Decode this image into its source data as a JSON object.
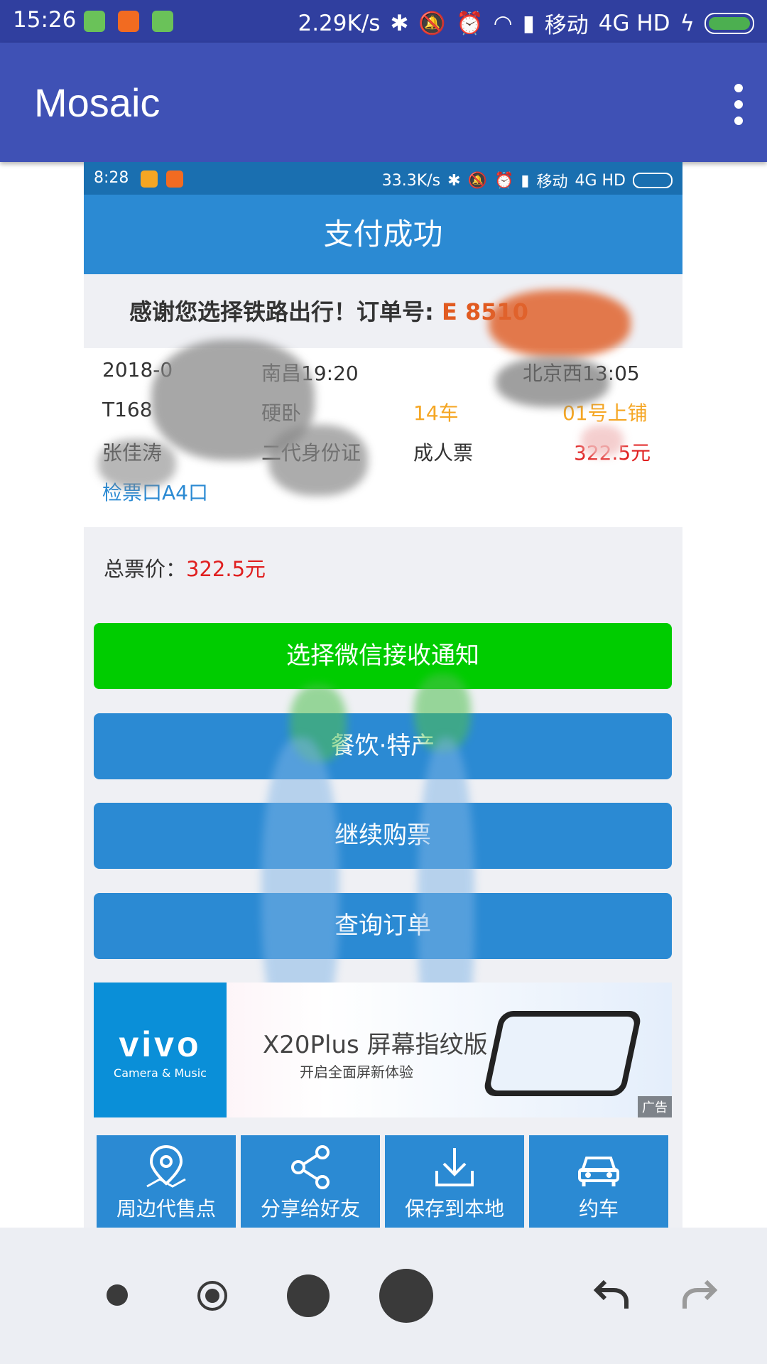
{
  "status_bar": {
    "time": "15:26",
    "net_speed": "2.29K/s",
    "carrier": "移动",
    "network": "4G HD"
  },
  "app_bar": {
    "title": "Mosaic"
  },
  "inner_screen": {
    "status_bar": {
      "time": "8:28",
      "net_speed": "33.3K/s",
      "carrier": "移动",
      "network": "4G HD"
    },
    "header_title": "支付成功",
    "thanks_label": "感谢您选择铁路出行！订单号: ",
    "order_no_visible": "E  8510",
    "ticket": {
      "date": "2018-0",
      "departure": "南昌19:20",
      "arrival": "北京西13:05",
      "train": "T168",
      "seat_class": "硬卧",
      "car": "14车",
      "berth": "01号上铺",
      "passenger": "张佳涛",
      "id_type": "二代身份证",
      "ticket_type": "成人票",
      "price": "322.5元",
      "gate": "检票口A4口"
    },
    "total_label": "总票价：",
    "total_price": "322.5元",
    "buttons": {
      "wechat": "选择微信接收通知",
      "food": "餐饮·特产",
      "buy_more": "继续购票",
      "orders": "查询订单"
    },
    "ad": {
      "brand": "vivo",
      "brand_sub": "Camera & Music",
      "headline": "X20Plus 屏幕指纹版",
      "subline": "开启全面屏新体验",
      "tag": "广告"
    },
    "tiles": [
      {
        "label": "周边代售点",
        "icon": "map-pin-icon"
      },
      {
        "label": "分享给好友",
        "icon": "share-icon"
      },
      {
        "label": "保存到本地",
        "icon": "download-icon"
      },
      {
        "label": "约车",
        "icon": "car-icon"
      }
    ]
  },
  "colors": {
    "status_bar": "#303f9f",
    "app_bar": "#3f51b5",
    "inner_blue": "#2b8ad3",
    "wechat_green": "#00cc00",
    "price_red": "#e02020"
  }
}
